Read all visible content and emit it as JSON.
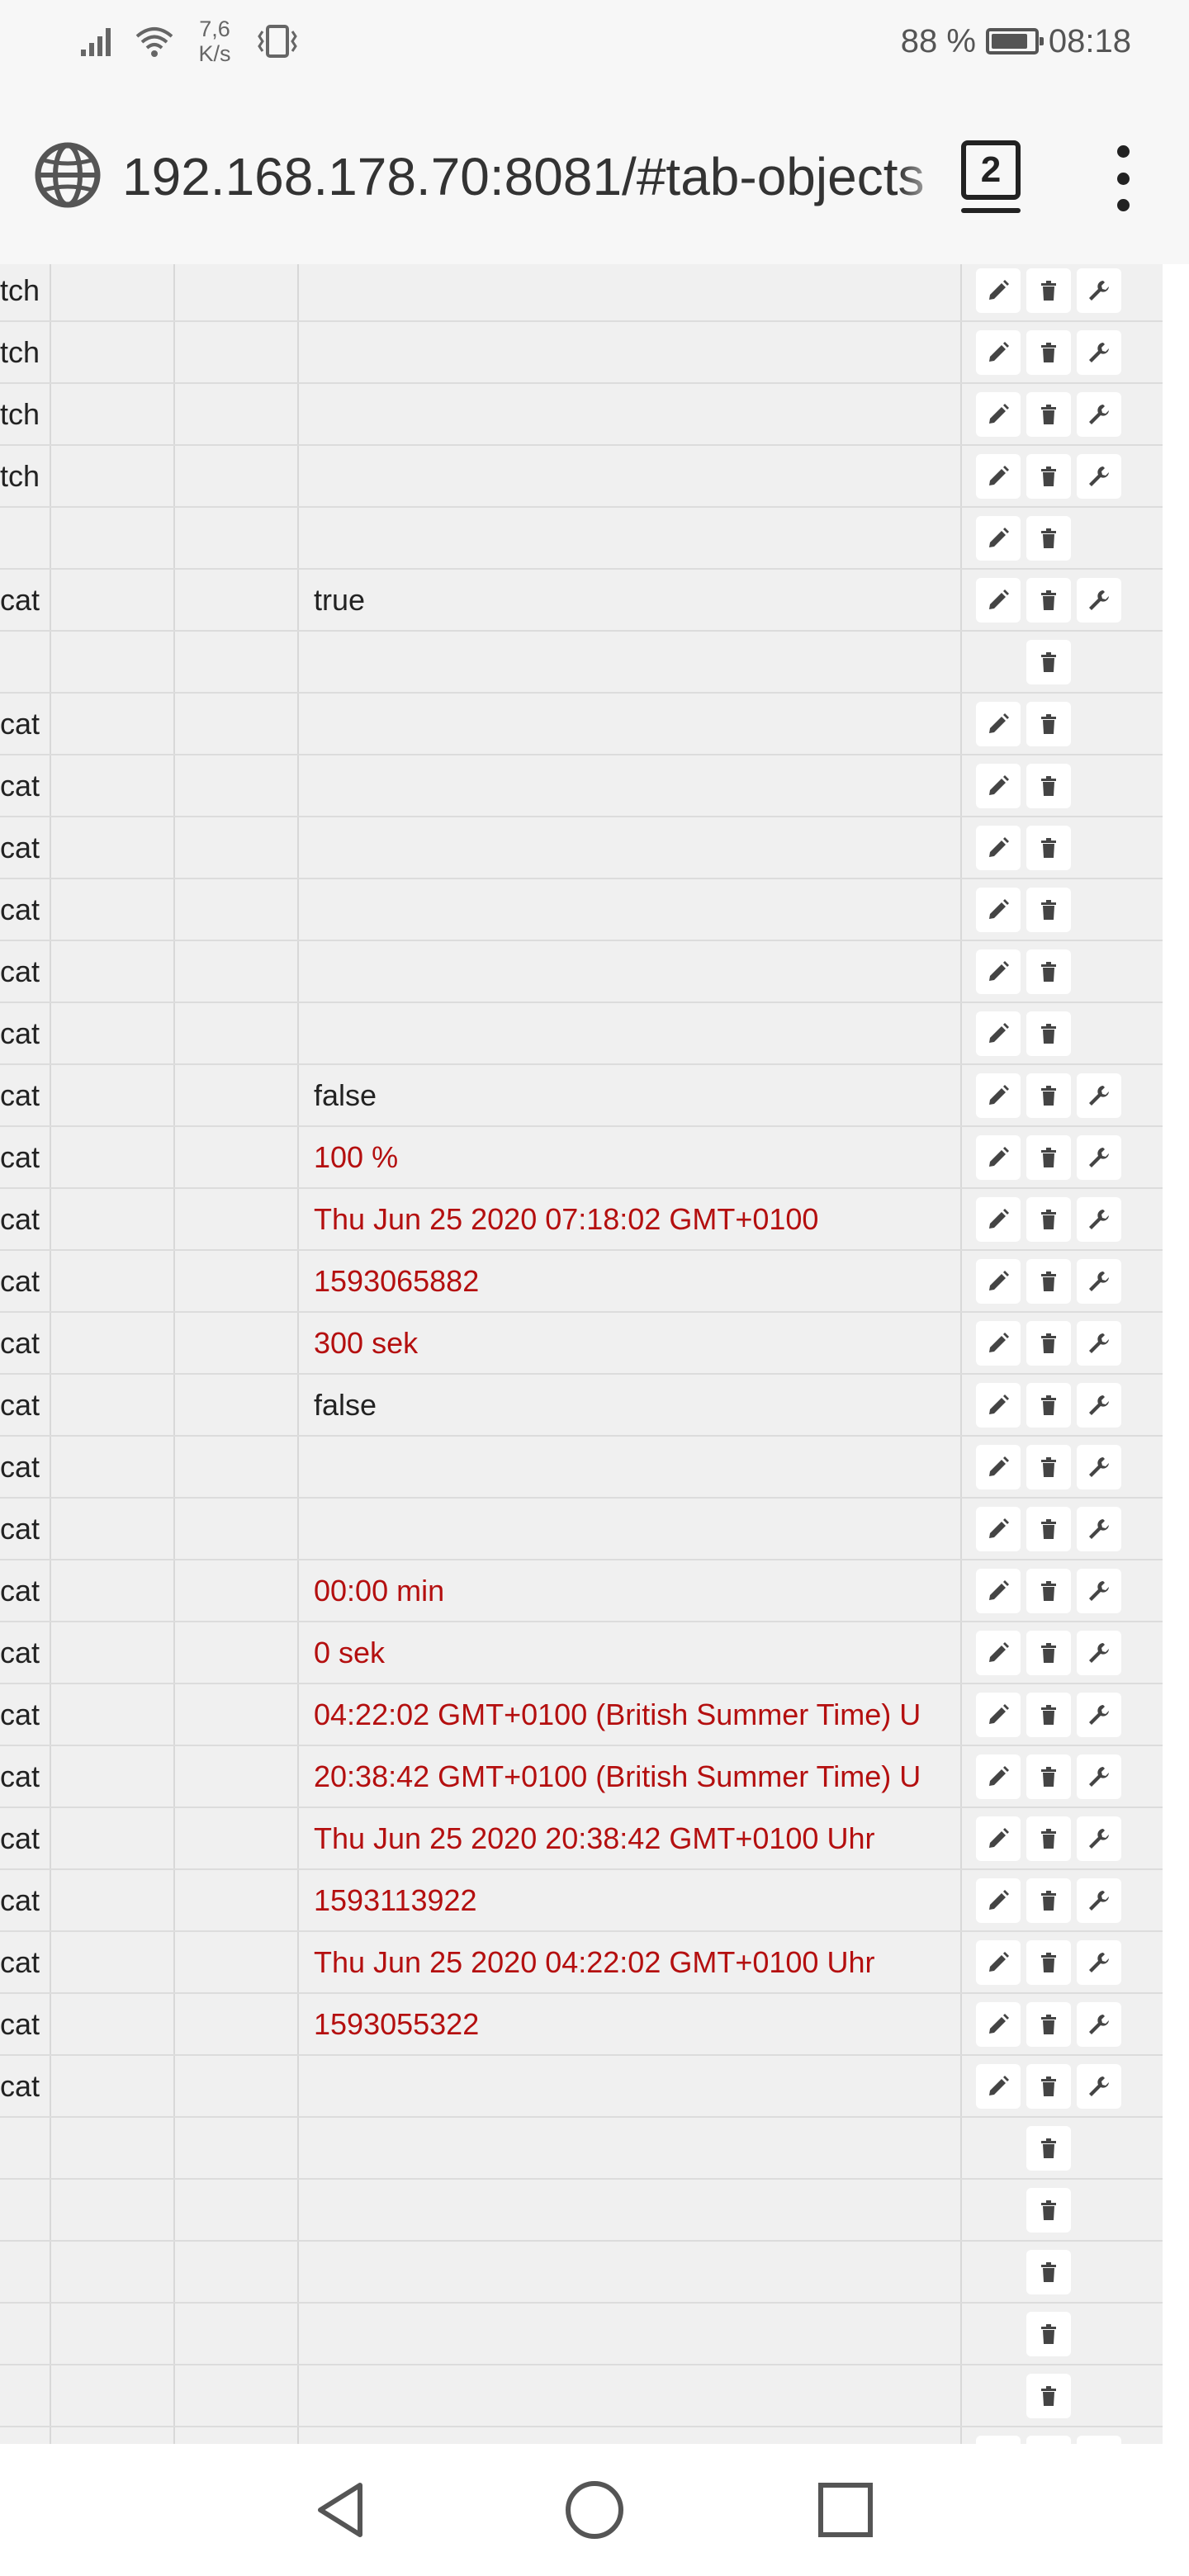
{
  "status_bar": {
    "net_speed_value": "7,6",
    "net_speed_unit": "K/s",
    "battery_percent": "88 %",
    "battery_level": 0.88,
    "time": "08:18"
  },
  "browser": {
    "url": "192.168.178.70:8081/#tab-objects",
    "tab_count": "2"
  },
  "table": {
    "rows": [
      {
        "name": "tch",
        "value": "",
        "value_color": "normal",
        "actions": [
          "edit",
          "delete",
          "wrench"
        ]
      },
      {
        "name": "tch",
        "value": "",
        "value_color": "normal",
        "actions": [
          "edit",
          "delete",
          "wrench"
        ]
      },
      {
        "name": "tch",
        "value": "",
        "value_color": "normal",
        "actions": [
          "edit",
          "delete",
          "wrench"
        ]
      },
      {
        "name": "tch",
        "value": "",
        "value_color": "normal",
        "actions": [
          "edit",
          "delete",
          "wrench"
        ]
      },
      {
        "name": "",
        "value": "",
        "value_color": "normal",
        "actions": [
          "edit",
          "delete"
        ]
      },
      {
        "name": "cat",
        "value": "true",
        "value_color": "normal",
        "actions": [
          "edit",
          "delete",
          "wrench"
        ]
      },
      {
        "name": "",
        "value": "",
        "value_color": "normal",
        "actions": [
          "delete"
        ]
      },
      {
        "name": "cat",
        "value": "",
        "value_color": "normal",
        "actions": [
          "edit",
          "delete"
        ]
      },
      {
        "name": "cat",
        "value": "",
        "value_color": "normal",
        "actions": [
          "edit",
          "delete"
        ]
      },
      {
        "name": "cat",
        "value": "",
        "value_color": "normal",
        "actions": [
          "edit",
          "delete"
        ]
      },
      {
        "name": "cat",
        "value": "",
        "value_color": "normal",
        "actions": [
          "edit",
          "delete"
        ]
      },
      {
        "name": "cat",
        "value": "",
        "value_color": "normal",
        "actions": [
          "edit",
          "delete"
        ]
      },
      {
        "name": "cat",
        "value": "",
        "value_color": "normal",
        "actions": [
          "edit",
          "delete"
        ]
      },
      {
        "name": "cat",
        "value": "false",
        "value_color": "normal",
        "actions": [
          "edit",
          "delete",
          "wrench"
        ]
      },
      {
        "name": "cat",
        "value": "100 %",
        "value_color": "red",
        "actions": [
          "edit",
          "delete",
          "wrench"
        ]
      },
      {
        "name": "cat",
        "value": "Thu Jun 25 2020 07:18:02 GMT+0100",
        "value_color": "red",
        "actions": [
          "edit",
          "delete",
          "wrench"
        ]
      },
      {
        "name": "cat",
        "value": "1593065882",
        "value_color": "red",
        "actions": [
          "edit",
          "delete",
          "wrench"
        ]
      },
      {
        "name": "cat",
        "value": "300 sek",
        "value_color": "red",
        "actions": [
          "edit",
          "delete",
          "wrench"
        ]
      },
      {
        "name": "cat",
        "value": "false",
        "value_color": "normal",
        "actions": [
          "edit",
          "delete",
          "wrench"
        ]
      },
      {
        "name": "cat",
        "value": "",
        "value_color": "normal",
        "actions": [
          "edit",
          "delete",
          "wrench"
        ]
      },
      {
        "name": "cat",
        "value": "",
        "value_color": "normal",
        "actions": [
          "edit",
          "delete",
          "wrench"
        ]
      },
      {
        "name": "cat",
        "value": "00:00 min",
        "value_color": "red",
        "actions": [
          "edit",
          "delete",
          "wrench"
        ]
      },
      {
        "name": "cat",
        "value": "0 sek",
        "value_color": "red",
        "actions": [
          "edit",
          "delete",
          "wrench"
        ]
      },
      {
        "name": "cat",
        "value": "04:22:02 GMT+0100 (British Summer Time) U",
        "value_color": "red",
        "actions": [
          "edit",
          "delete",
          "wrench"
        ]
      },
      {
        "name": "cat",
        "value": "20:38:42 GMT+0100 (British Summer Time) U",
        "value_color": "red",
        "actions": [
          "edit",
          "delete",
          "wrench"
        ]
      },
      {
        "name": "cat",
        "value": "Thu Jun 25 2020 20:38:42 GMT+0100 Uhr",
        "value_color": "red",
        "actions": [
          "edit",
          "delete",
          "wrench"
        ]
      },
      {
        "name": "cat",
        "value": "1593113922",
        "value_color": "red",
        "actions": [
          "edit",
          "delete",
          "wrench"
        ]
      },
      {
        "name": "cat",
        "value": "Thu Jun 25 2020 04:22:02 GMT+0100 Uhr",
        "value_color": "red",
        "actions": [
          "edit",
          "delete",
          "wrench"
        ]
      },
      {
        "name": "cat",
        "value": "1593055322",
        "value_color": "red",
        "actions": [
          "edit",
          "delete",
          "wrench"
        ]
      },
      {
        "name": "cat",
        "value": "",
        "value_color": "normal",
        "actions": [
          "edit",
          "delete",
          "wrench"
        ]
      },
      {
        "name": "",
        "value": "",
        "value_color": "normal",
        "actions": [
          "delete"
        ]
      },
      {
        "name": "",
        "value": "",
        "value_color": "normal",
        "actions": [
          "delete"
        ]
      },
      {
        "name": "",
        "value": "",
        "value_color": "normal",
        "actions": [
          "delete"
        ]
      },
      {
        "name": "",
        "value": "",
        "value_color": "normal",
        "actions": [
          "delete"
        ]
      },
      {
        "name": "",
        "value": "",
        "value_color": "normal",
        "actions": [
          "delete"
        ]
      },
      {
        "name": "",
        "value": "",
        "value_color": "normal",
        "actions": [
          "edit",
          "delete",
          "wrench"
        ]
      }
    ]
  },
  "colors": {
    "value_red": "#b40f0f",
    "row_background": "#f0f0f0",
    "icon": "#444444"
  },
  "icons": {
    "edit": "pencil-icon",
    "delete": "trash-icon",
    "wrench": "wrench-icon"
  }
}
